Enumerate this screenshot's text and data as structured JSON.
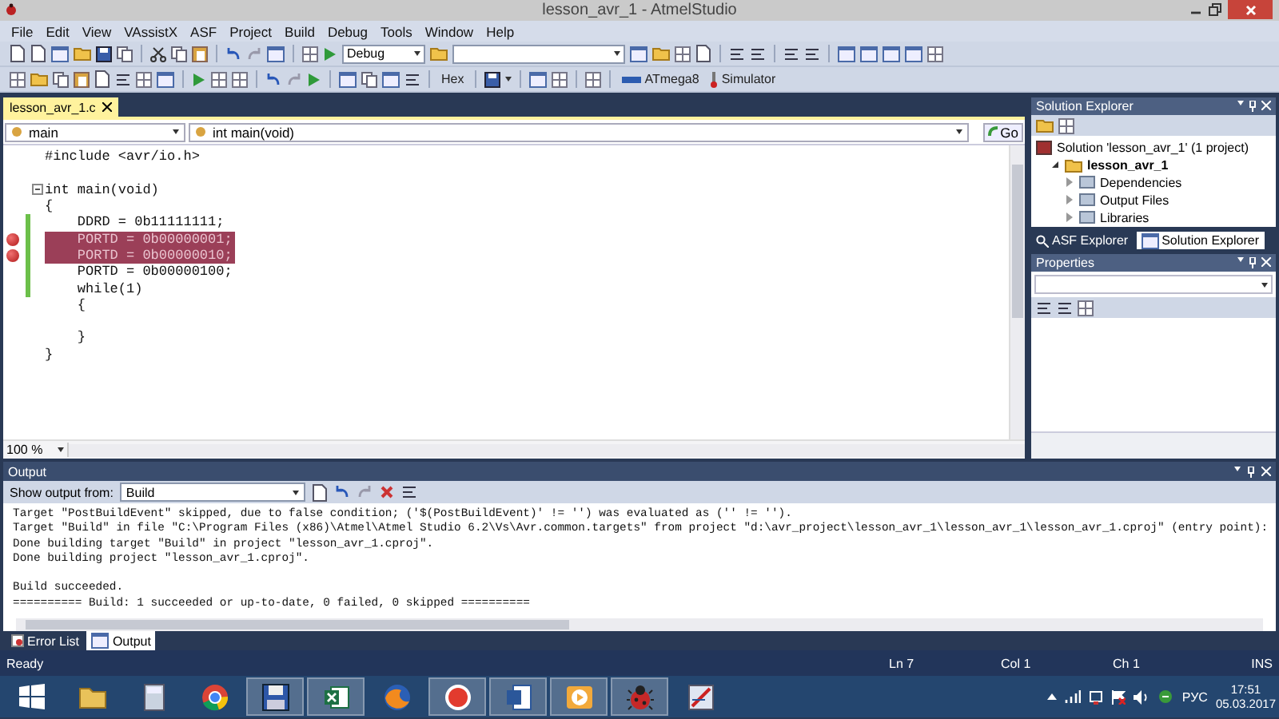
{
  "window": {
    "title": "lesson_avr_1 - AtmelStudio"
  },
  "menu": [
    "File",
    "Edit",
    "View",
    "VAssistX",
    "ASF",
    "Project",
    "Build",
    "Debug",
    "Tools",
    "Window",
    "Help"
  ],
  "toolbar": {
    "configuration": "Debug",
    "hex_button": "Hex",
    "device": "ATmega8",
    "tool": "Simulator"
  },
  "document_tabs": [
    {
      "label": "lesson_avr_1.c",
      "selected": true
    }
  ],
  "editor": {
    "scope": "main",
    "member": "int main(void)",
    "go_button": "Go",
    "zoom": "100 %",
    "lines": [
      {
        "text": "#include <avr/io.h>",
        "breakpoint": false,
        "changed": false,
        "foldable": false
      },
      {
        "breakpoint": false,
        "changed": false,
        "foldable": false
      },
      {
        "text": "int main(void)",
        "breakpoint": false,
        "changed": false,
        "foldable": true
      },
      {
        "text": "{",
        "breakpoint": false,
        "changed": false,
        "foldable": false
      },
      {
        "text": "    DDRD = 0b11111111;",
        "breakpoint": false,
        "changed": true,
        "foldable": false
      },
      {
        "text": "    PORTD = 0b00000001;",
        "breakpoint": true,
        "changed": true,
        "foldable": false
      },
      {
        "text": "    PORTD = 0b00000010;",
        "breakpoint": true,
        "changed": true,
        "foldable": false
      },
      {
        "text": "    PORTD = 0b00000100;",
        "breakpoint": false,
        "changed": true,
        "foldable": false
      },
      {
        "text": "    while(1)",
        "breakpoint": false,
        "changed": true,
        "foldable": false
      },
      {
        "text": "    {",
        "breakpoint": false,
        "changed": false,
        "foldable": false
      },
      {
        "breakpoint": false,
        "changed": false,
        "foldable": false
      },
      {
        "text": "    }",
        "breakpoint": false,
        "changed": false,
        "foldable": false
      },
      {
        "text": "}",
        "breakpoint": false,
        "changed": false,
        "foldable": false
      }
    ]
  },
  "solution_explorer": {
    "title": "Solution Explorer",
    "root": "Solution 'lesson_avr_1' (1 project)",
    "tree": [
      {
        "label": "lesson_avr_1",
        "expanded": true,
        "children": [
          {
            "label": "Dependencies",
            "expanded": false
          },
          {
            "label": "Output Files",
            "expanded": false
          },
          {
            "label": "Libraries",
            "expanded": false
          }
        ]
      }
    ],
    "tabs": [
      {
        "label": "ASF Explorer",
        "selected": false
      },
      {
        "label": "Solution Explorer",
        "selected": true
      }
    ]
  },
  "properties": {
    "title": "Properties"
  },
  "output": {
    "title": "Output",
    "source_label": "Show output from:",
    "source": "Build",
    "lines": [
      {
        "text": "Target \"PostBuildEvent\" skipped, due to false condition; ('$(PostBuildEvent)' != '') was evaluated as ('' != '').",
        "gap_before": false
      },
      {
        "text": "Target \"Build\" in file \"C:\\Program Files (x86)\\Atmel\\Atmel Studio 6.2\\Vs\\Avr.common.targets\" from project \"d:\\avr_project\\lesson_avr_1\\lesson_avr_1\\lesson_avr_1.cproj\" (entry point):",
        "gap_before": false
      },
      {
        "text": "Done building target \"Build\" in project \"lesson_avr_1.cproj\".",
        "gap_before": false
      },
      {
        "text": "Done building project \"lesson_avr_1.cproj\".",
        "gap_before": false
      },
      {
        "text": "Build succeeded.",
        "gap_before": true
      },
      {
        "text": "========== Build: 1 succeeded or up-to-date, 0 failed, 0 skipped ==========",
        "gap_before": false
      }
    ]
  },
  "bottom_tabs": [
    {
      "label": "Error List",
      "selected": false
    },
    {
      "label": "Output",
      "selected": true
    }
  ],
  "status_bar": {
    "message": "Ready",
    "line": "Ln 7",
    "column": "Col 1",
    "char": "Ch 1",
    "mode": "INS"
  },
  "taskbar": {
    "apps": [
      {
        "kind": "folder",
        "running": false
      },
      {
        "kind": "calculator",
        "running": false
      },
      {
        "kind": "browser",
        "running": false
      },
      {
        "kind": "floppy",
        "running": true
      },
      {
        "kind": "spreadsheet",
        "running": true
      },
      {
        "kind": "globe",
        "running": false
      },
      {
        "kind": "circle",
        "running": true
      },
      {
        "kind": "document",
        "running": true
      },
      {
        "kind": "player",
        "running": true
      },
      {
        "kind": "bug",
        "running": true
      },
      {
        "kind": "pen",
        "running": false
      }
    ],
    "language": "РУС",
    "time": "17:51",
    "date": "05.03.2017"
  }
}
